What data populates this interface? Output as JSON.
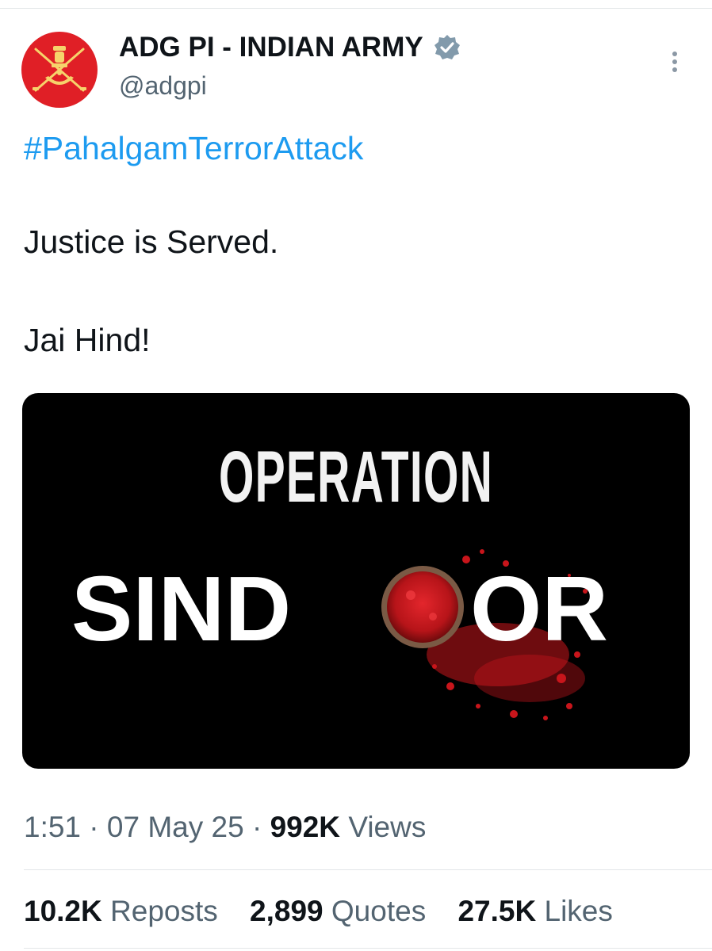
{
  "account": {
    "display_name": "ADG PI - INDIAN ARMY",
    "handle": "@adgpi",
    "avatar_icon": "indian-army-emblem-icon",
    "verified_icon": "verified-badge-icon",
    "more_icon": "more-options-icon"
  },
  "tweet": {
    "hashtag": "#PahalgamTerrorAttack",
    "line1": "Justice is Served.",
    "line2": "Jai Hind!"
  },
  "media": {
    "line1": "OPERATION",
    "line2_part1": "SIND",
    "line2_part2": "OR"
  },
  "meta": {
    "time": "1:51",
    "separator": "·",
    "date": "07 May 25",
    "views_count": "992K",
    "views_label": "Views"
  },
  "stats": {
    "reposts_count": "10.2K",
    "reposts_label": "Reposts",
    "quotes_count": "2,899",
    "quotes_label": "Quotes",
    "likes_count": "27.5K",
    "likes_label": "Likes"
  },
  "colors": {
    "link_blue": "#1d9bf0",
    "muted": "#536471",
    "text": "#0f1419",
    "avatar_red": "#e01f26",
    "sindoor_red": "#d81f26"
  }
}
